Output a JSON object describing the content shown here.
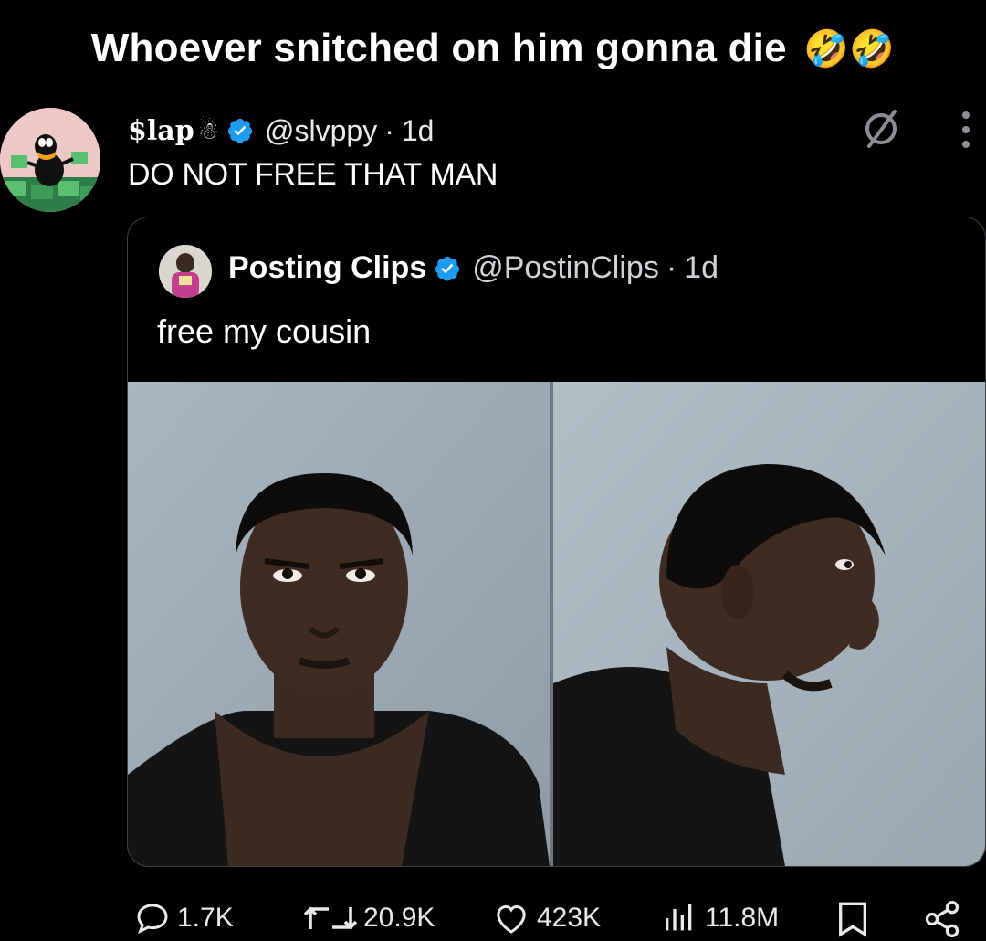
{
  "caption": {
    "text": "Whoever snitched on him gonna die",
    "emoji": "🤣🤣"
  },
  "tweet": {
    "display_name": "$lap",
    "handle": "@slvppy",
    "time": "1d",
    "separator": "·",
    "text": "DO NOT FREE THAT MAN"
  },
  "quote": {
    "display_name": "Posting Clips",
    "handle": "@PostinClips",
    "time": "1d",
    "separator": "·",
    "text": "free my cousin"
  },
  "actions": {
    "replies": "1.7K",
    "reposts": "20.9K",
    "likes": "423K",
    "views": "11.8M"
  },
  "colors": {
    "background": "#000000",
    "verified": "#1d9bf0",
    "text": "#e7e9ea",
    "border": "#3a3d41"
  }
}
